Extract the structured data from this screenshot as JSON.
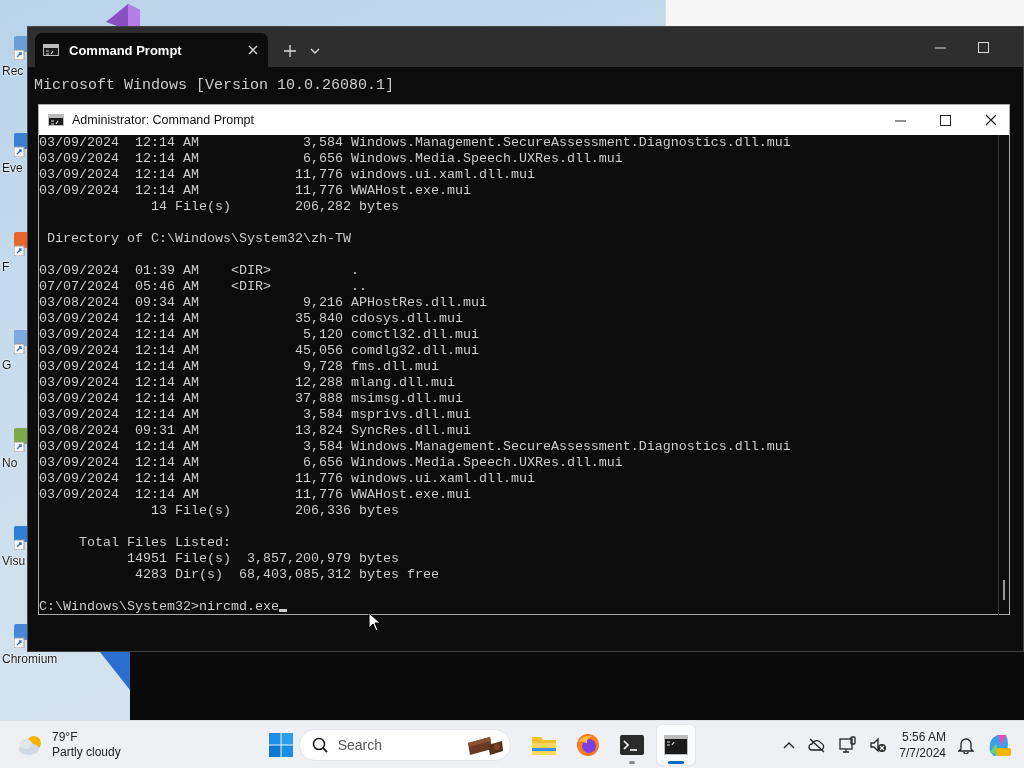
{
  "desktop": {
    "icons": [
      {
        "label": "Rec"
      },
      {
        "label": "Eve"
      },
      {
        "label": "F"
      },
      {
        "label": "G"
      },
      {
        "label": "No"
      },
      {
        "label": "Visu"
      },
      {
        "label": "Chromium"
      }
    ]
  },
  "terminal": {
    "tabs": [
      {
        "title": "Command Prompt",
        "selected": true
      }
    ],
    "lines": [
      "Microsoft Windows [Version 10.0.26080.1]"
    ]
  },
  "console": {
    "title": "Administrator: Command Prompt",
    "cursor": true,
    "blocks": [
      [
        "03/09/2024  12:14 AM             3,584 Windows.Management.SecureAssessment.Diagnostics.dll.mui",
        "03/09/2024  12:14 AM             6,656 Windows.Media.Speech.UXRes.dll.mui",
        "03/09/2024  12:14 AM            11,776 windows.ui.xaml.dll.mui",
        "03/09/2024  12:14 AM            11,776 WWAHost.exe.mui",
        "              14 File(s)        206,282 bytes"
      ],
      [
        " Directory of C:\\Windows\\System32\\zh-TW"
      ],
      [
        "03/09/2024  01:39 AM    <DIR>          .",
        "07/07/2024  05:46 AM    <DIR>          ..",
        "03/08/2024  09:34 AM             9,216 APHostRes.dll.mui",
        "03/09/2024  12:14 AM            35,840 cdosys.dll.mui",
        "03/09/2024  12:14 AM             5,120 comctl32.dll.mui",
        "03/09/2024  12:14 AM            45,056 comdlg32.dll.mui",
        "03/09/2024  12:14 AM             9,728 fms.dll.mui",
        "03/09/2024  12:14 AM            12,288 mlang.dll.mui",
        "03/09/2024  12:14 AM            37,888 msimsg.dll.mui",
        "03/09/2024  12:14 AM             3,584 msprivs.dll.mui",
        "03/08/2024  09:31 AM            13,824 SyncRes.dll.mui",
        "03/09/2024  12:14 AM             3,584 Windows.Management.SecureAssessment.Diagnostics.dll.mui",
        "03/09/2024  12:14 AM             6,656 Windows.Media.Speech.UXRes.dll.mui",
        "03/09/2024  12:14 AM            11,776 windows.ui.xaml.dll.mui",
        "03/09/2024  12:14 AM            11,776 WWAHost.exe.mui",
        "              13 File(s)        206,336 bytes"
      ],
      [
        "     Total Files Listed:",
        "           14951 File(s)  3,857,200,979 bytes",
        "            4283 Dir(s)  68,403,085,312 bytes free"
      ],
      [
        "C:\\Windows\\System32>nircmd.exe"
      ]
    ]
  },
  "taskbar": {
    "weather": {
      "temperature": "79°F",
      "condition": "Partly cloudy"
    },
    "search": {
      "placeholder": "Search"
    },
    "apps": [
      {
        "kind": "explorer",
        "running": false,
        "active": false
      },
      {
        "kind": "firefox",
        "running": false,
        "active": false
      },
      {
        "kind": "terminal",
        "running": true,
        "active": false
      },
      {
        "kind": "cmd",
        "running": true,
        "active": true
      }
    ],
    "clock": {
      "time": "5:56 AM",
      "date": "7/7/2024"
    }
  }
}
